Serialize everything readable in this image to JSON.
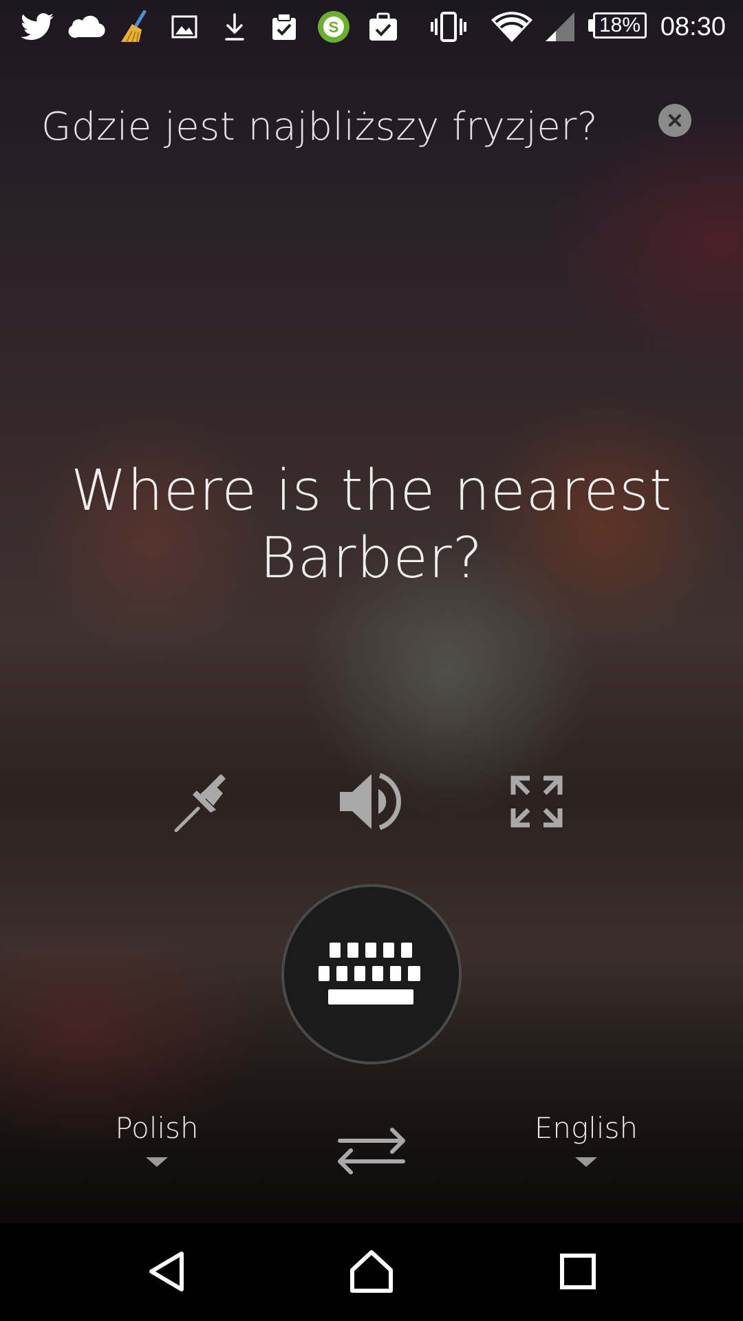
{
  "status_bar": {
    "notification_icons": [
      "twitter-icon",
      "cloud-icon",
      "broom-icon",
      "image-icon",
      "download-icon",
      "clipboard-check-icon",
      "shazam-icon",
      "briefcase-check-icon"
    ],
    "system_icons": [
      "vibrate-icon",
      "wifi-icon",
      "signal-icon"
    ],
    "battery_percent": "18%",
    "time": "08:30",
    "colors": {
      "shazam": "#6aaf2e"
    }
  },
  "translation": {
    "source_text": "Gdzie jest najbliższy fryzjer?",
    "translated_text": "Where is the nearest Barber?"
  },
  "actions": {
    "pin_icon": "pin-icon",
    "speaker_icon": "speaker-icon",
    "fullscreen_icon": "fullscreen-icon",
    "keyboard_icon": "keyboard-icon",
    "close_icon": "close-icon"
  },
  "languages": {
    "source": "Polish",
    "target": "English",
    "swap_icon": "swap-arrows-icon"
  },
  "nav_bar": {
    "icons": [
      "back-icon",
      "home-icon",
      "recents-icon"
    ]
  }
}
